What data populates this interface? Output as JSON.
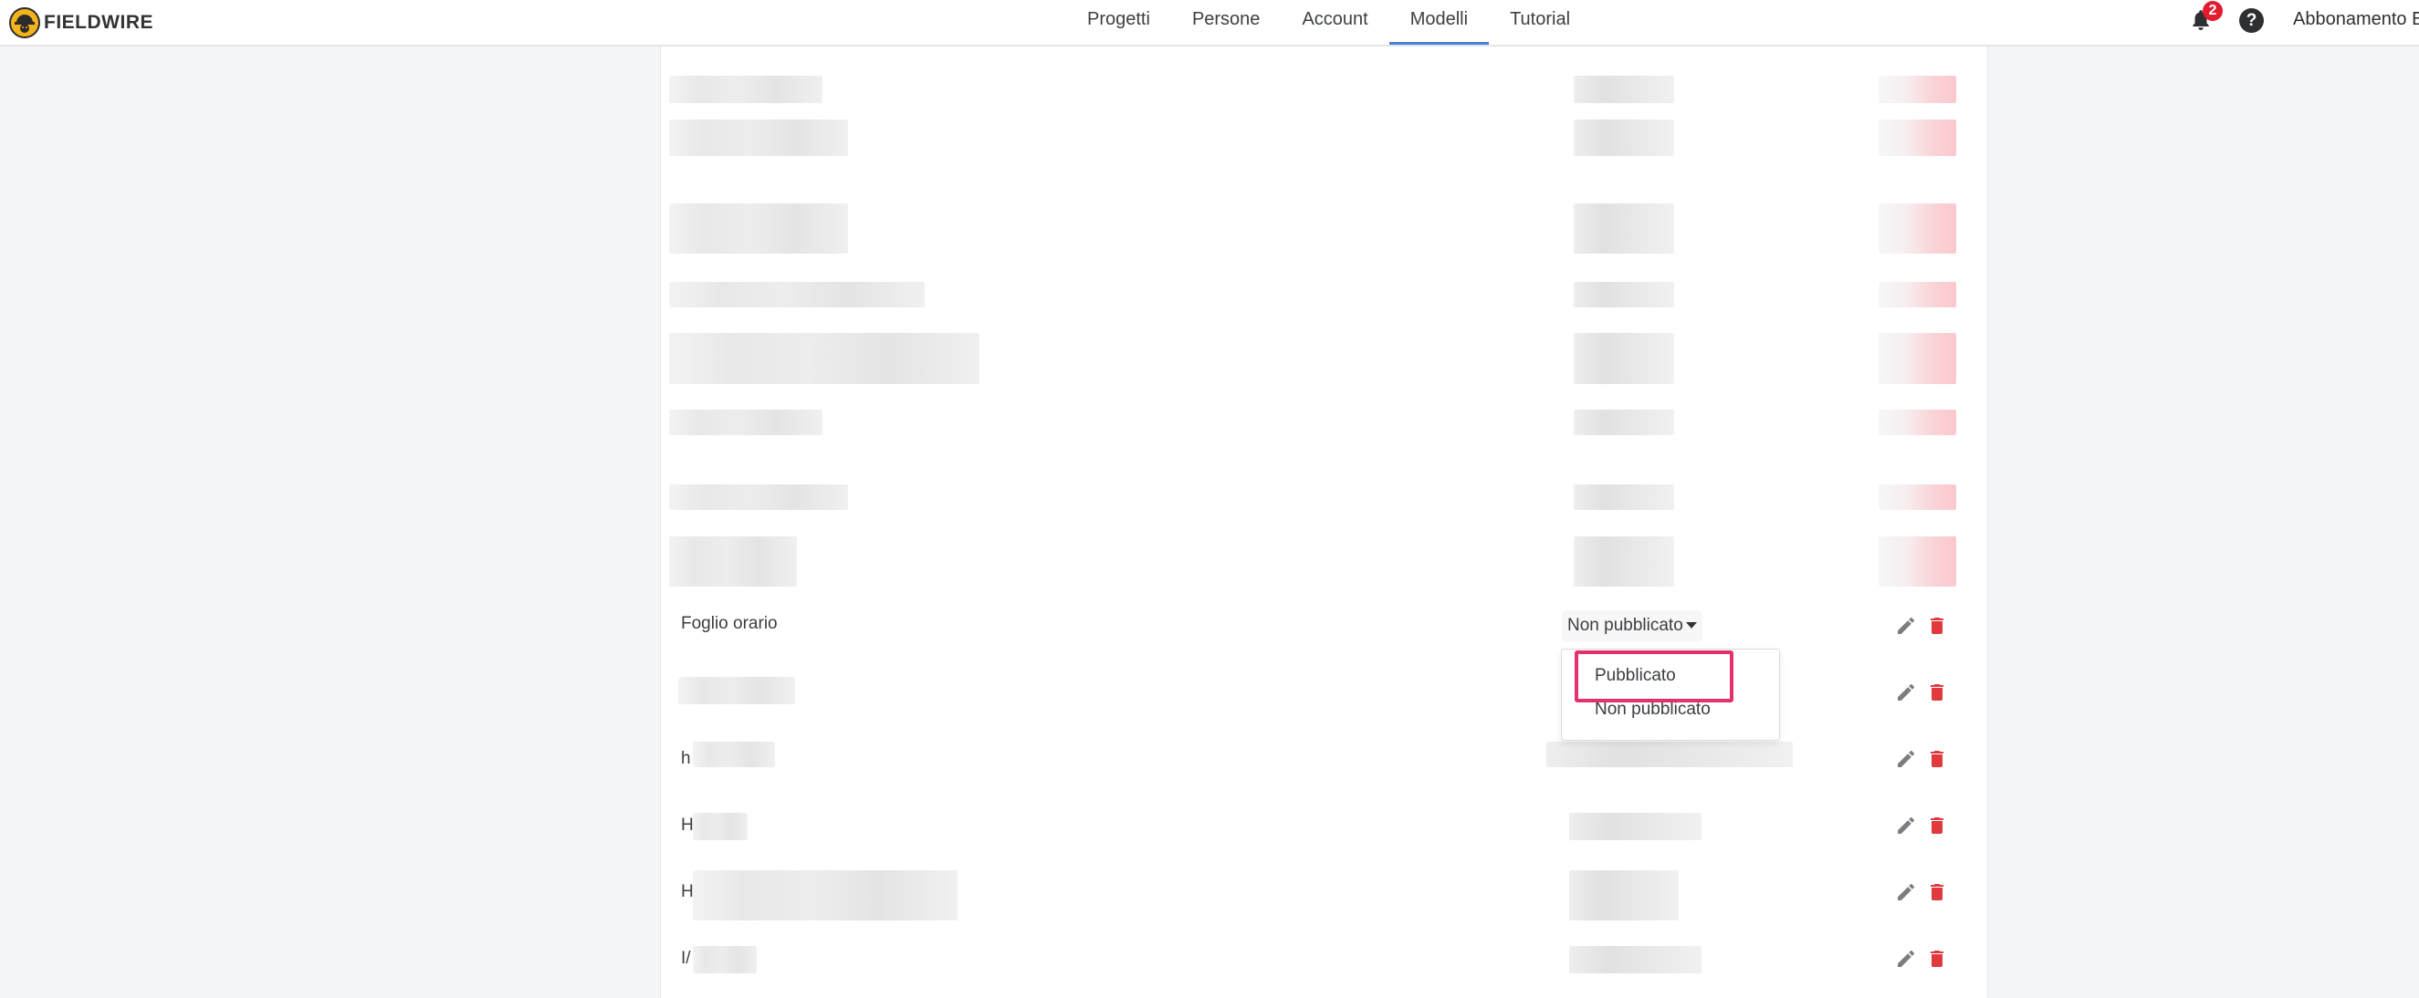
{
  "app": {
    "brand": "FIELDWIRE",
    "accent": "#4a7fd6"
  },
  "nav": {
    "items": [
      {
        "label": "Progetti",
        "active": false
      },
      {
        "label": "Persone",
        "active": false
      },
      {
        "label": "Account",
        "active": false
      },
      {
        "label": "Modelli",
        "active": true
      },
      {
        "label": "Tutorial",
        "active": false
      }
    ]
  },
  "header": {
    "notifications_count": "2",
    "help_label": "?",
    "subscription_label": "Abbonamento E"
  },
  "table": {
    "visible_rows": [
      {
        "name": "Foglio orario",
        "status": "Non pubblicato"
      },
      {
        "name": "",
        "status": ""
      },
      {
        "name": "h",
        "status": ""
      },
      {
        "name": "H",
        "status": ""
      },
      {
        "name": "H",
        "status": ""
      },
      {
        "name": "I/",
        "status": ""
      }
    ],
    "action_icons": [
      "pencil-icon",
      "trash-icon"
    ],
    "trash_color": "#e0393e"
  },
  "status_dropdown": {
    "options": [
      "Pubblicato",
      "Non pubblicato"
    ],
    "highlight_color": "#e5306e"
  }
}
